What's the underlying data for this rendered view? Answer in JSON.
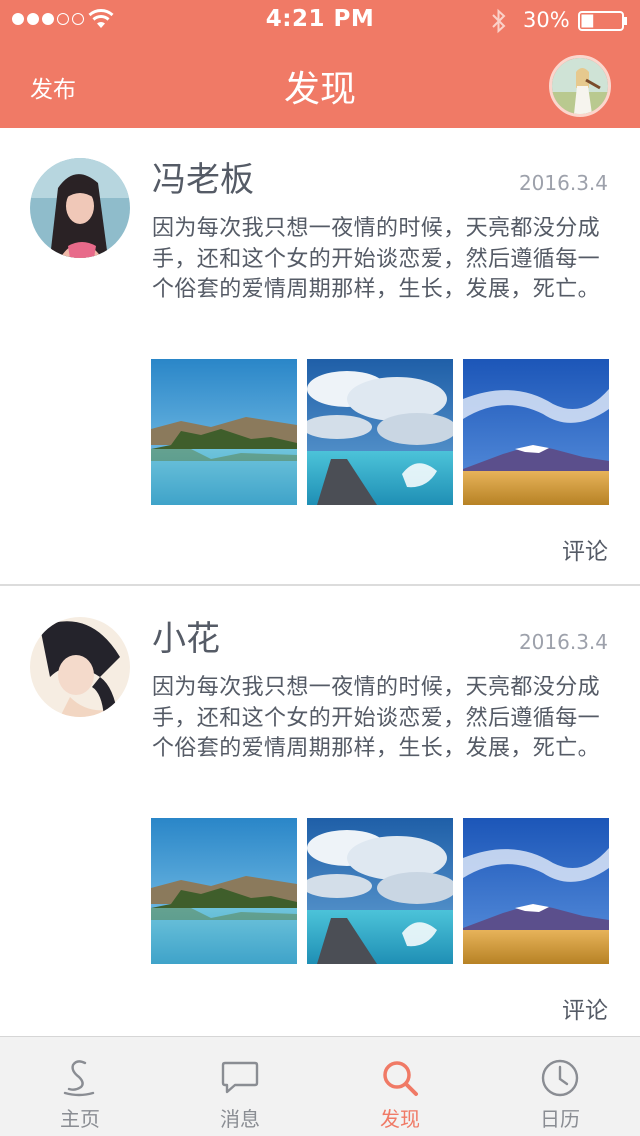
{
  "status_bar": {
    "time": "4:21 PM",
    "battery_percent": "30%",
    "battery_level": 0.3,
    "signal_bars_filled": 3,
    "signal_bars_total": 5
  },
  "nav": {
    "publish_label": "发布",
    "title": "发现"
  },
  "posts": [
    {
      "name": "冯老板",
      "date": "2016.3.4",
      "text": "因为每次我只想一夜情的时候，天亮都没分成手，还和这个女的开始谈恋爱，然后遵循每一个俗套的爱情周期那样，生长，发展，死亡。",
      "comment_label": "评论"
    },
    {
      "name": "小花",
      "date": "2016.3.4",
      "text": "因为每次我只想一夜情的时候，天亮都没分成手，还和这个女的开始谈恋爱，然后遵循每一个俗套的爱情周期那样，生长，发展，死亡。",
      "comment_label": "评论"
    }
  ],
  "tabs": [
    {
      "label": "主页",
      "icon": "home-icon",
      "active": false
    },
    {
      "label": "消息",
      "icon": "message-icon",
      "active": false
    },
    {
      "label": "发现",
      "icon": "search-icon",
      "active": true
    },
    {
      "label": "日历",
      "icon": "clock-icon",
      "active": false
    }
  ],
  "colors": {
    "accent": "#f07a66",
    "text": "#555b66",
    "date": "#9da1ab",
    "tab_inactive": "#8a8d93"
  }
}
